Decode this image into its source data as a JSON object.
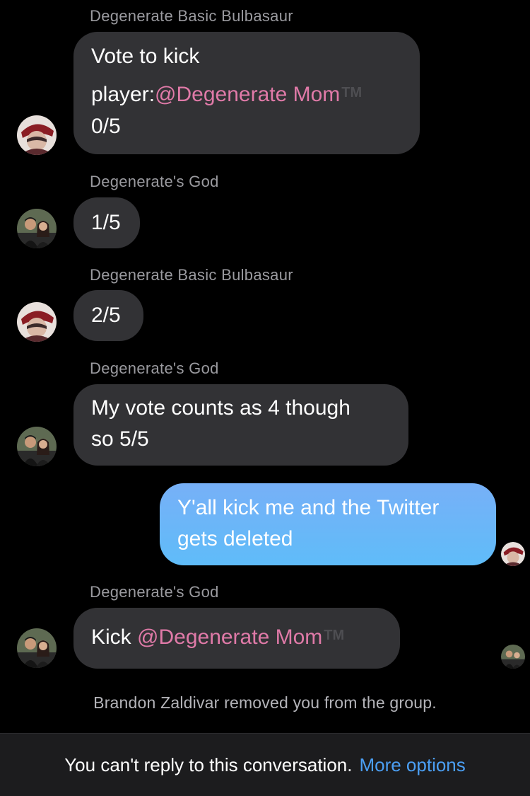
{
  "messages": [
    {
      "sender": "Degenerate Basic Bulbasaur",
      "line1": "Vote to kick",
      "line2_prefix": "player:",
      "mention": "@Degenerate Mom",
      "tm": "TM",
      "line3": "0/5"
    },
    {
      "sender": "Degenerate's God",
      "text": "1/5"
    },
    {
      "sender": "Degenerate Basic Bulbasaur",
      "text": "2/5"
    },
    {
      "sender": "Degenerate's God",
      "line1": "My vote counts as 4 though",
      "line2": "so 5/5"
    },
    {
      "line1": "Y'all kick me and the Twitter",
      "line2": "gets deleted"
    },
    {
      "sender": "Degenerate's God",
      "prefix": "Kick ",
      "mention": "@Degenerate Mom",
      "tm": "TM"
    }
  ],
  "system_note": "Brandon Zaldivar removed you from the group.",
  "footer": {
    "text": "You can't reply to this conversation.",
    "link": "More options"
  },
  "colors": {
    "background": "#000000",
    "incoming_bubble": "#323235",
    "outgoing_bubble": "#6db5f8",
    "mention": "#e07aa8",
    "link": "#4b9ff4"
  },
  "icons": {
    "bulbasaur_avatar": "cartoon-character-avatar-icon",
    "god_avatar": "couple-photo-avatar-icon",
    "read_receipt": "read-receipt-avatar-icon"
  }
}
